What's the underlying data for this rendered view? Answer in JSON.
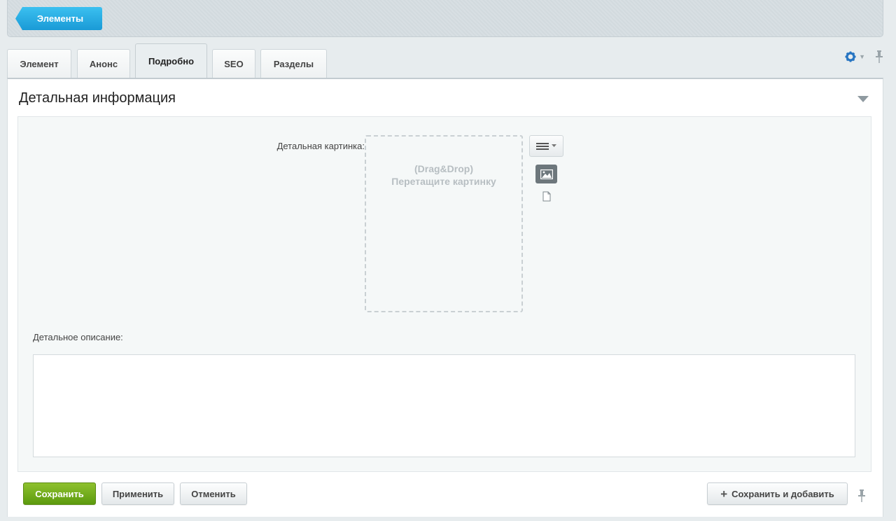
{
  "toolbar": {
    "back_label": "Элементы"
  },
  "tabs": [
    {
      "label": "Элемент"
    },
    {
      "label": "Анонс"
    },
    {
      "label": "Подробно"
    },
    {
      "label": "SEO"
    },
    {
      "label": "Разделы"
    }
  ],
  "active_tab": "Подробно",
  "tab_tools": {
    "settings_icon": "gear-icon",
    "pin_icon": "pin-icon"
  },
  "section": {
    "title": "Детальная информация"
  },
  "detail_picture": {
    "label": "Детальная картинка:",
    "dropzone_line1": "(Drag&Drop)",
    "dropzone_line2": "Перетащите картинку"
  },
  "detail_description": {
    "label": "Детальное описание:",
    "value": ""
  },
  "buttons": {
    "save": "Сохранить",
    "apply": "Применить",
    "cancel": "Отменить",
    "save_and_add": "Сохранить и добавить"
  },
  "colors": {
    "accent_blue": "#1a9ad6",
    "save_green": "#6aa81a"
  }
}
